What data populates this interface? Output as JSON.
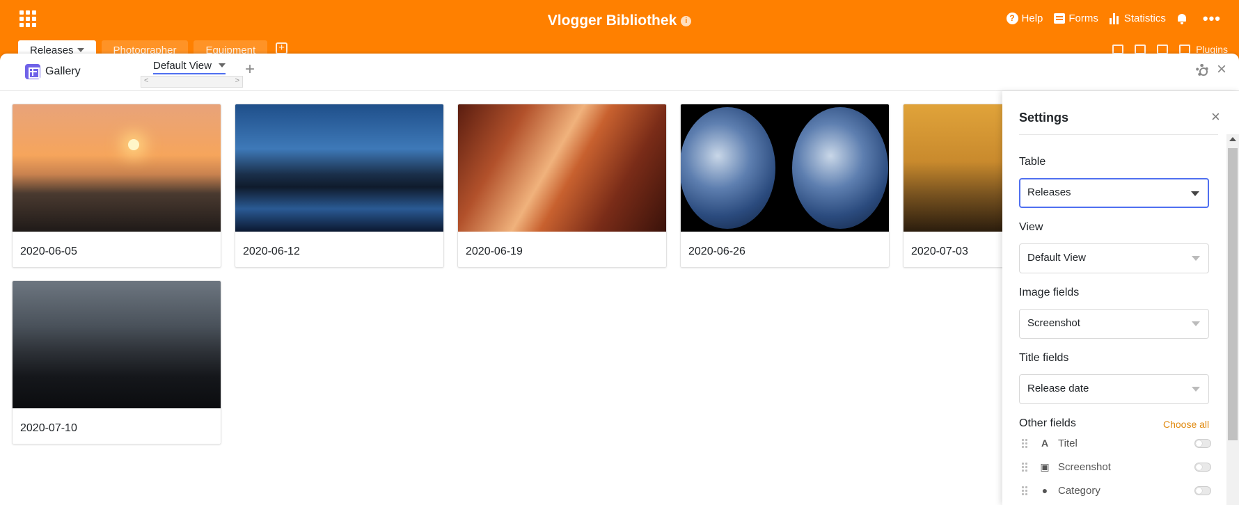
{
  "header": {
    "app_title": "Vlogger Bibliothek",
    "help_label": "Help",
    "forms_label": "Forms",
    "statistics_label": "Statistics",
    "more_label": "•••",
    "plugins_label": "Plugins"
  },
  "table_tabs": [
    {
      "label": "Releases",
      "active": true
    },
    {
      "label": "Photographer",
      "active": false
    },
    {
      "label": "Equipment",
      "active": false
    }
  ],
  "plugin": {
    "name": "Gallery",
    "view_tab": "Default View"
  },
  "gallery": {
    "cards": [
      {
        "title": "2020-06-05",
        "image": "ocean-sunset"
      },
      {
        "title": "2020-06-12",
        "image": "yosemite-winter"
      },
      {
        "title": "2020-06-19",
        "image": "antelope-canyon"
      },
      {
        "title": "2020-06-26",
        "image": "earth-hemispheres"
      },
      {
        "title": "2020-07-03",
        "image": "giraffe-silhouette"
      },
      {
        "title": "2020-07-10",
        "image": "shanghai-skyline"
      }
    ]
  },
  "settings": {
    "title": "Settings",
    "table_label": "Table",
    "table_value": "Releases",
    "view_label": "View",
    "view_value": "Default View",
    "image_fields_label": "Image fields",
    "image_fields_value": "Screenshot",
    "title_fields_label": "Title fields",
    "title_fields_value": "Release date",
    "other_fields_label": "Other fields",
    "choose_all_label": "Choose all",
    "other_fields": [
      {
        "name": "Titel",
        "icon": "text-icon",
        "enabled": false
      },
      {
        "name": "Screenshot",
        "icon": "image-icon",
        "enabled": false
      },
      {
        "name": "Category",
        "icon": "single-select-icon",
        "enabled": false
      }
    ]
  },
  "colors": {
    "brand": "#ff8000",
    "accent": "#4f6ff0",
    "gallery_icon": "#6f62e8",
    "link": "#e0890e"
  }
}
